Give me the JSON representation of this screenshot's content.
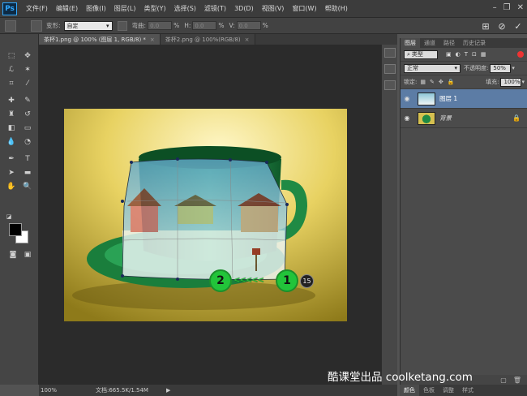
{
  "app": {
    "logo": "Ps"
  },
  "menu": [
    "文件(F)",
    "编辑(E)",
    "图像(I)",
    "图层(L)",
    "类型(Y)",
    "选择(S)",
    "滤镜(T)",
    "3D(D)",
    "视图(V)",
    "窗口(W)",
    "帮助(H)"
  ],
  "options": {
    "transform_label": "变形:",
    "transform_value": "自定",
    "bend_label": "弯曲:",
    "bend_value": "0.0",
    "h_label": "H:",
    "h_value": "0.0",
    "v_label": "V:",
    "v_value": "0.0",
    "percent": "%"
  },
  "tabs": [
    {
      "label": "茶杯1.png @ 100% (图层 1, RGB/8) *",
      "close": "×"
    },
    {
      "label": "茶杯2.png @ 100%(RGB/8)",
      "close": "×"
    }
  ],
  "annotation": {
    "step1": "1",
    "step2": "2",
    "arrow": "<<<<<",
    "badge": "15"
  },
  "status": {
    "zoom": "100%",
    "doc": "文档:665.5K/1.54M",
    "arrow": "▶"
  },
  "layers_panel": {
    "tabs": [
      "图层",
      "通道",
      "路径",
      "历史记录"
    ],
    "filter_type": "类型",
    "blend_mode": "正常",
    "opacity_label": "不透明度:",
    "opacity_value": "50%",
    "lock_label": "锁定:",
    "fill_label": "填充:",
    "fill_value": "100%",
    "layers": [
      {
        "name": "图层 1",
        "selected": true
      },
      {
        "name": "背景",
        "selected": false,
        "locked": true
      }
    ]
  },
  "bottom_tabs": [
    "颜色",
    "色板",
    "调整",
    "样式"
  ],
  "watermark": "酷课堂出品 coolketang.com",
  "colors": {
    "accent_green": "#22c43a",
    "selection_blue": "#5c7ca5",
    "ps_blue": "#30a8ff"
  }
}
